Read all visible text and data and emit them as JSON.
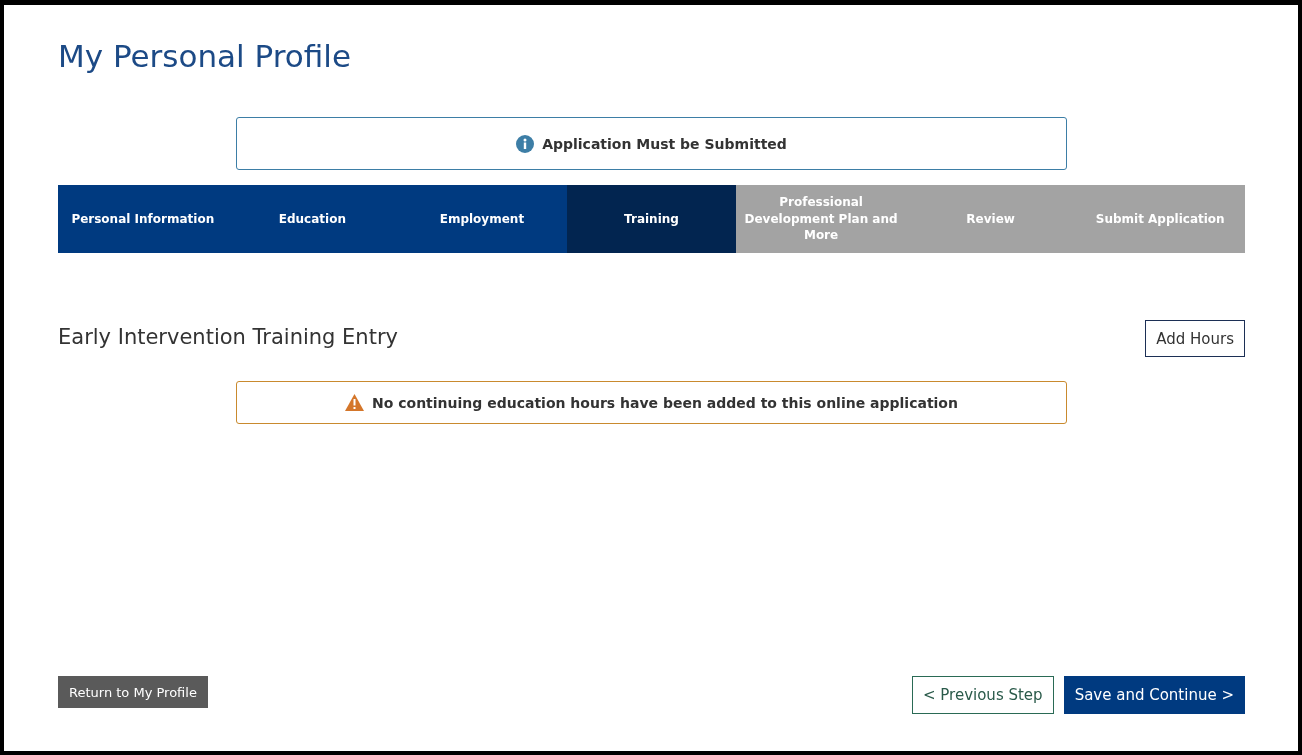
{
  "page": {
    "title": "My Personal Profile"
  },
  "notice": {
    "kind": "info",
    "text": "Application Must be Submitted"
  },
  "steps": [
    {
      "label": "Personal Information",
      "disabled": false,
      "selected": false
    },
    {
      "label": "Education",
      "disabled": false,
      "selected": false
    },
    {
      "label": "Employment",
      "disabled": false,
      "selected": false
    },
    {
      "label": "Training",
      "disabled": false,
      "selected": true
    },
    {
      "label": "Professional Development Plan and More",
      "disabled": true,
      "selected": false
    },
    {
      "label": "Review",
      "disabled": true,
      "selected": false
    },
    {
      "label": "Submit Application",
      "disabled": true,
      "selected": false
    }
  ],
  "section": {
    "title": "Early Intervention Training Entry",
    "add_button": "Add Hours"
  },
  "warning": {
    "kind": "warning",
    "text": "No continuing education hours have been added to this online application"
  },
  "footer": {
    "return_button": "Return to My Profile",
    "previous_button": "< Previous Step",
    "next_button": "Save and Continue >"
  }
}
